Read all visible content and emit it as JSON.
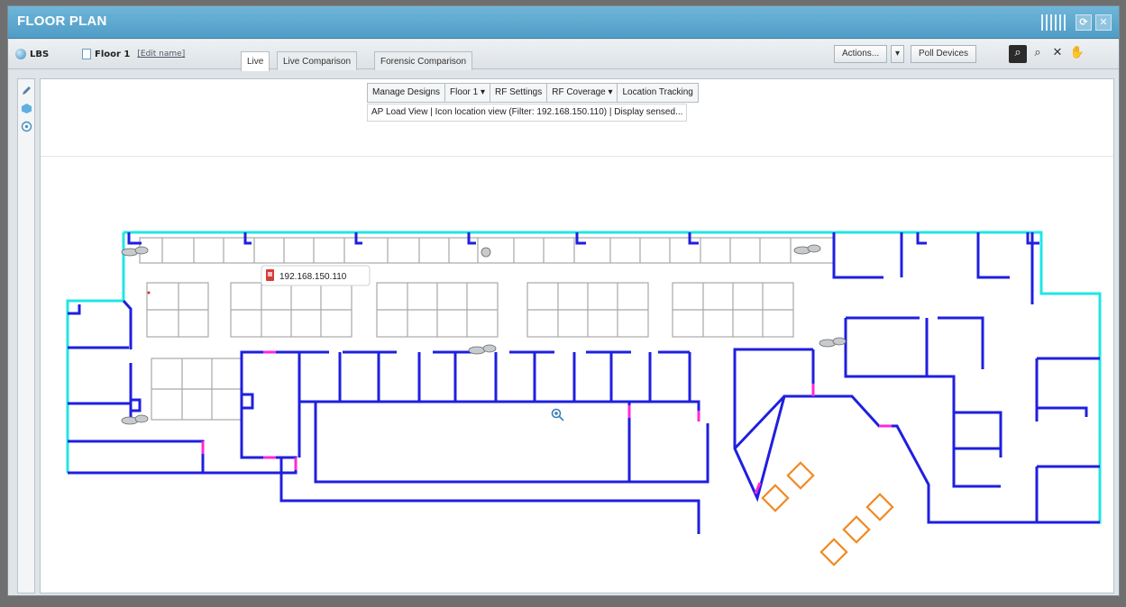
{
  "window": {
    "title": "FLOOR PLAN"
  },
  "toolbar": {
    "site_label": "LBS",
    "floor_label": "Floor 1",
    "edit_link": "[Edit name]",
    "tabs": [
      {
        "label": "Live",
        "active": true
      },
      {
        "label": "Live Comparison",
        "active": false
      },
      {
        "label": "Forensic Comparison",
        "active": false
      }
    ],
    "actions_label": "Actions...",
    "actions_dropdown": "▾",
    "poll_label": "Poll Devices"
  },
  "map_toolbar": {
    "manage_designs": "Manage Designs",
    "floor_select": "Floor 1 ▾",
    "rf_settings": "RF Settings",
    "rf_coverage": "RF Coverage ▾",
    "location_tracking": "Location Tracking",
    "status_line": "AP Load View  |  Icon location view (Filter: 192.168.150.110)  |  Display sensed..."
  },
  "device": {
    "ip": "192.168.150.110"
  },
  "icons": {
    "window": [
      "grip-icon",
      "refresh-icon",
      "close-icon"
    ],
    "view": [
      "zoom-fit-icon",
      "zoom-icon",
      "expand-icon",
      "pan-hand-icon"
    ],
    "leftbar": [
      "pencil-icon",
      "cube-icon",
      "target-icon"
    ],
    "map": [
      "access-point-icon",
      "device-icon",
      "magnifier-icon"
    ]
  },
  "colors": {
    "title_bar": "#5aa8d0",
    "wall": "#1f1fe0",
    "outer_wall": "#22e5e5",
    "door": "#ff2ad4",
    "furniture_outline": "#f08a24",
    "grid_outline": "#a8a8a8"
  }
}
